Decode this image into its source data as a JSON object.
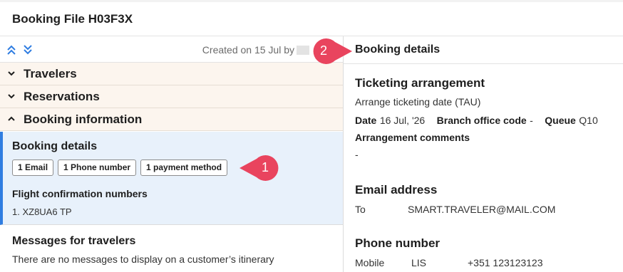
{
  "title": "Booking File H03F3X",
  "toolbar": {
    "created_text": "Created on 15 Jul by"
  },
  "sections": {
    "travelers": "Travelers",
    "reservations": "Reservations",
    "booking_information": "Booking information"
  },
  "booking_details_card": {
    "heading": "Booking details",
    "chips": [
      "1 Email",
      "1 Phone number",
      "1 payment method"
    ],
    "flight_conf_heading": "Flight confirmation numbers",
    "flight_conf_value": "1. XZ8UA6 TP"
  },
  "messages": {
    "heading": "Messages for travelers",
    "text": "There are no messages to display on a customer’s itinerary"
  },
  "callouts": [
    "1",
    "2"
  ],
  "right_panel": {
    "header": "Booking details",
    "ticketing": {
      "heading": "Ticketing arrangement",
      "arrangement": "Arrange ticketing date (TAU)",
      "date_label": "Date",
      "date_value": "16 Jul, '26",
      "branch_label": "Branch office code",
      "branch_value": "-",
      "queue_label": "Queue",
      "queue_value": "Q10",
      "comments_label": "Arrangement comments",
      "comments_value": "-"
    },
    "email": {
      "heading": "Email address",
      "type": "To",
      "value": "SMART.TRAVELER@MAIL.COM"
    },
    "phone": {
      "heading": "Phone number",
      "type": "Mobile",
      "location": "LIS",
      "value": "+351 123123123"
    }
  },
  "colors": {
    "accent": "#2f7de1",
    "callout": "#e9445e",
    "section_bg": "#fcf5ee",
    "selected_bg": "#e8f1fb"
  }
}
